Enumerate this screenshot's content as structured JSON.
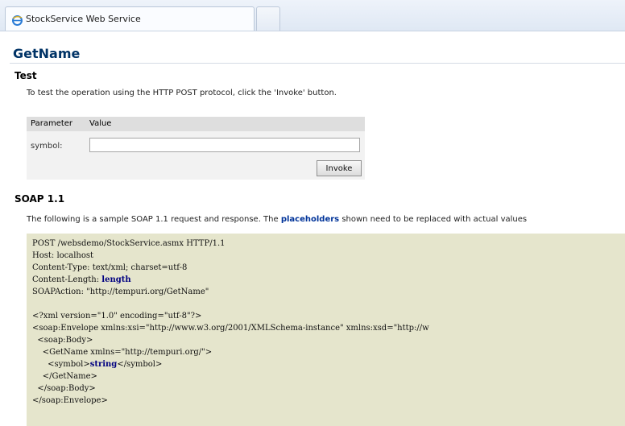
{
  "browser": {
    "tab_title": "StockService Web Service"
  },
  "operation": {
    "title": "GetName"
  },
  "test": {
    "heading": "Test",
    "description": "To test the operation using the HTTP POST protocol, click the 'Invoke' button.",
    "table": {
      "col_parameter": "Parameter",
      "col_value": "Value",
      "param_name": "symbol:",
      "param_value": "",
      "invoke_label": "Invoke"
    }
  },
  "soap": {
    "heading": "SOAP 1.1",
    "desc_before": "The following is a sample SOAP 1.1 request and response. The ",
    "desc_link": "placeholders",
    "desc_after": " shown need to be replaced with actual values",
    "code": {
      "l1": "POST /websdemo/StockService.asmx HTTP/1.1",
      "l2": "Host: localhost",
      "l3": "Content-Type: text/xml; charset=utf-8",
      "l4a": "Content-Length: ",
      "l4b": "length",
      "l5": "SOAPAction: \"http://tempuri.org/GetName\"",
      "l6": "<?xml version=\"1.0\" encoding=\"utf-8\"?>",
      "l7": "<soap:Envelope xmlns:xsi=\"http://www.w3.org/2001/XMLSchema-instance\" xmlns:xsd=\"http://w",
      "l8": "  <soap:Body>",
      "l9": "    <GetName xmlns=\"http://tempuri.org/\">",
      "l10a": "      <symbol>",
      "l10b": "string",
      "l10c": "</symbol>",
      "l11": "    </GetName>",
      "l12": "  </soap:Body>",
      "l13": "</soap:Envelope>"
    }
  }
}
